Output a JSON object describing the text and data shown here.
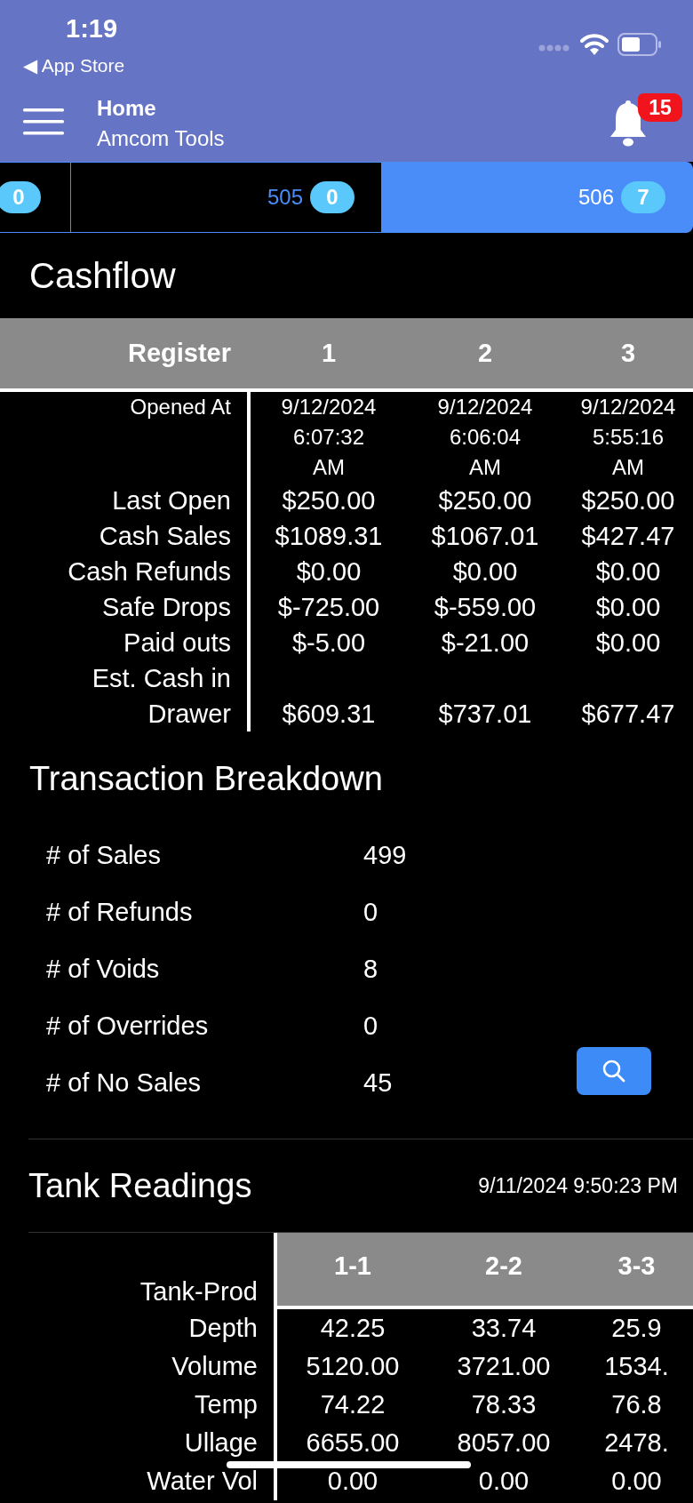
{
  "status_bar": {
    "time": "1:19",
    "back_label": "◀ App Store"
  },
  "header": {
    "title": "Home",
    "subtitle": "Amcom Tools",
    "notification_count": "15"
  },
  "tabs": [
    {
      "badge": "0",
      "selected": false
    },
    {
      "label": "505",
      "badge": "0",
      "selected": false
    },
    {
      "label": "506",
      "badge": "7",
      "selected": true
    }
  ],
  "cashflow": {
    "title": "Cashflow",
    "columns": [
      "Register",
      "1",
      "2",
      "3"
    ],
    "rows": [
      {
        "label": "Opened At",
        "kind": "small",
        "values": [
          "9/12/2024 6:07:32 AM",
          "9/12/2024 6:06:04 AM",
          "9/12/2024 5:55:16 AM"
        ]
      },
      {
        "label": "Last Open",
        "kind": "normal",
        "values": [
          "$250.00",
          "$250.00",
          "$250.00"
        ]
      },
      {
        "label": "Cash Sales",
        "kind": "normal",
        "values": [
          "$1089.31",
          "$1067.01",
          "$427.47"
        ]
      },
      {
        "label": "Cash Refunds",
        "kind": "normal",
        "values": [
          "$0.00",
          "$0.00",
          "$0.00"
        ]
      },
      {
        "label": "Safe Drops",
        "kind": "normal",
        "values": [
          "$-725.00",
          "$-559.00",
          "$0.00"
        ]
      },
      {
        "label": "Paid outs",
        "kind": "normal",
        "values": [
          "$-5.00",
          "$-21.00",
          "$0.00"
        ]
      },
      {
        "label": "Est. Cash in Drawer",
        "kind": "normal",
        "values": [
          "$609.31",
          "$737.01",
          "$677.47"
        ]
      }
    ]
  },
  "transaction_breakdown": {
    "title": "Transaction Breakdown",
    "rows": [
      {
        "label": "# of Sales",
        "value": "499"
      },
      {
        "label": "# of Refunds",
        "value": "0"
      },
      {
        "label": "# of Voids",
        "value": "8"
      },
      {
        "label": "# of Overrides",
        "value": "0"
      },
      {
        "label": "# of No Sales",
        "value": "45"
      }
    ]
  },
  "tank_readings": {
    "title": "Tank Readings",
    "timestamp": "9/11/2024 9:50:23 PM",
    "columns": [
      "Tank-Prod",
      "1-1",
      "2-2",
      "3-3"
    ],
    "rows": [
      {
        "label": "Depth",
        "values": [
          "42.25",
          "33.74",
          "25.9"
        ]
      },
      {
        "label": "Volume",
        "values": [
          "5120.00",
          "3721.00",
          "1534."
        ]
      },
      {
        "label": "Temp",
        "values": [
          "74.22",
          "78.33",
          "76.8"
        ]
      },
      {
        "label": "Ullage",
        "values": [
          "6655.00",
          "8057.00",
          "2478."
        ]
      },
      {
        "label": "Water Vol",
        "values": [
          "0.00",
          "0.00",
          "0.00"
        ]
      }
    ]
  }
}
